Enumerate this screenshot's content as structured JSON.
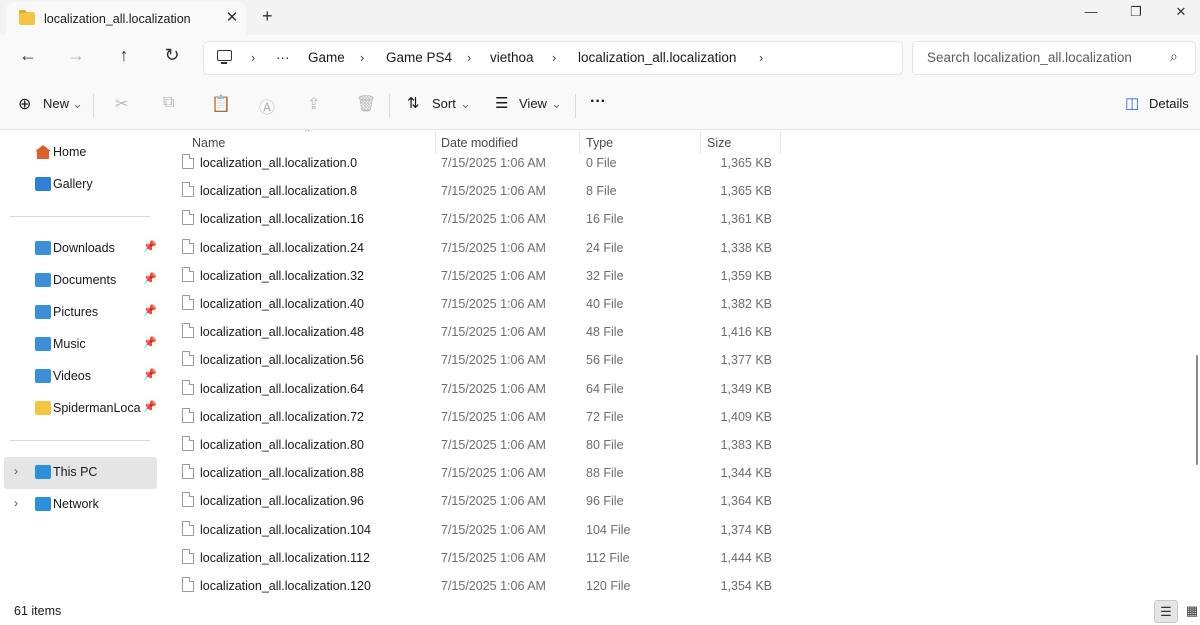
{
  "window": {
    "tab_title": "localization_all.localization",
    "tab_close": "✕",
    "new_tab": "+",
    "minimize": "—",
    "maximize": "❐",
    "close": "✕"
  },
  "nav": {
    "back": "←",
    "forward": "→",
    "up": "↑",
    "refresh": "↻"
  },
  "breadcrumb": {
    "overflow": "···",
    "separator": "›",
    "items": [
      "Game",
      "Game PS4",
      "viethoa",
      "localization_all.localization"
    ]
  },
  "search": {
    "placeholder": "Search localization_all.localization",
    "icon": "⌕"
  },
  "commandbar": {
    "new_label": "New",
    "new_icon": "⊕",
    "sort_label": "Sort",
    "sort_icon": "⇅",
    "view_label": "View",
    "view_icon": "☰",
    "more": "···",
    "details_label": "Details",
    "details_icon": "◫",
    "caret": "⌄",
    "cut_icon": "✂",
    "copy_icon": "⧉",
    "paste_icon": "📋",
    "rename_icon": "Ⓐ",
    "share_icon": "⇪",
    "delete_icon": "🗑"
  },
  "sidebar": {
    "pin_icon": "📌",
    "chevron": "›",
    "items": [
      {
        "label": "Home",
        "color": "#d9602b"
      },
      {
        "label": "Gallery",
        "color": "#2b7fd9"
      },
      {
        "label": "Downloads",
        "color": "#3a8fd9"
      },
      {
        "label": "Documents",
        "color": "#3a8fd9"
      },
      {
        "label": "Pictures",
        "color": "#3a8fd9"
      },
      {
        "label": "Music",
        "color": "#3a8fd9"
      },
      {
        "label": "Videos",
        "color": "#3a8fd9"
      },
      {
        "label": "SpidermanLocali",
        "color": "#f4c542"
      },
      {
        "label": "This PC",
        "color": "#2b8fd9"
      },
      {
        "label": "Network",
        "color": "#2b8fd9"
      }
    ]
  },
  "columns": {
    "name": "Name",
    "date": "Date modified",
    "type": "Type",
    "size": "Size",
    "sort_caret": "^"
  },
  "files": [
    {
      "name": "localization_all.localization.0",
      "date": "7/15/2025 1:06 AM",
      "type": "0 File",
      "size": "1,365 KB"
    },
    {
      "name": "localization_all.localization.8",
      "date": "7/15/2025 1:06 AM",
      "type": "8 File",
      "size": "1,365 KB"
    },
    {
      "name": "localization_all.localization.16",
      "date": "7/15/2025 1:06 AM",
      "type": "16 File",
      "size": "1,361 KB"
    },
    {
      "name": "localization_all.localization.24",
      "date": "7/15/2025 1:06 AM",
      "type": "24 File",
      "size": "1,338 KB"
    },
    {
      "name": "localization_all.localization.32",
      "date": "7/15/2025 1:06 AM",
      "type": "32 File",
      "size": "1,359 KB"
    },
    {
      "name": "localization_all.localization.40",
      "date": "7/15/2025 1:06 AM",
      "type": "40 File",
      "size": "1,382 KB"
    },
    {
      "name": "localization_all.localization.48",
      "date": "7/15/2025 1:06 AM",
      "type": "48 File",
      "size": "1,416 KB"
    },
    {
      "name": "localization_all.localization.56",
      "date": "7/15/2025 1:06 AM",
      "type": "56 File",
      "size": "1,377 KB"
    },
    {
      "name": "localization_all.localization.64",
      "date": "7/15/2025 1:06 AM",
      "type": "64 File",
      "size": "1,349 KB"
    },
    {
      "name": "localization_all.localization.72",
      "date": "7/15/2025 1:06 AM",
      "type": "72 File",
      "size": "1,409 KB"
    },
    {
      "name": "localization_all.localization.80",
      "date": "7/15/2025 1:06 AM",
      "type": "80 File",
      "size": "1,383 KB"
    },
    {
      "name": "localization_all.localization.88",
      "date": "7/15/2025 1:06 AM",
      "type": "88 File",
      "size": "1,344 KB"
    },
    {
      "name": "localization_all.localization.96",
      "date": "7/15/2025 1:06 AM",
      "type": "96 File",
      "size": "1,364 KB"
    },
    {
      "name": "localization_all.localization.104",
      "date": "7/15/2025 1:06 AM",
      "type": "104 File",
      "size": "1,374 KB"
    },
    {
      "name": "localization_all.localization.112",
      "date": "7/15/2025 1:06 AM",
      "type": "112 File",
      "size": "1,444 KB"
    },
    {
      "name": "localization_all.localization.120",
      "date": "7/15/2025 1:06 AM",
      "type": "120 File",
      "size": "1,354 KB"
    }
  ],
  "status": {
    "item_count": "61 items",
    "details_view_icon": "☰",
    "tiles_view_icon": "▦"
  }
}
